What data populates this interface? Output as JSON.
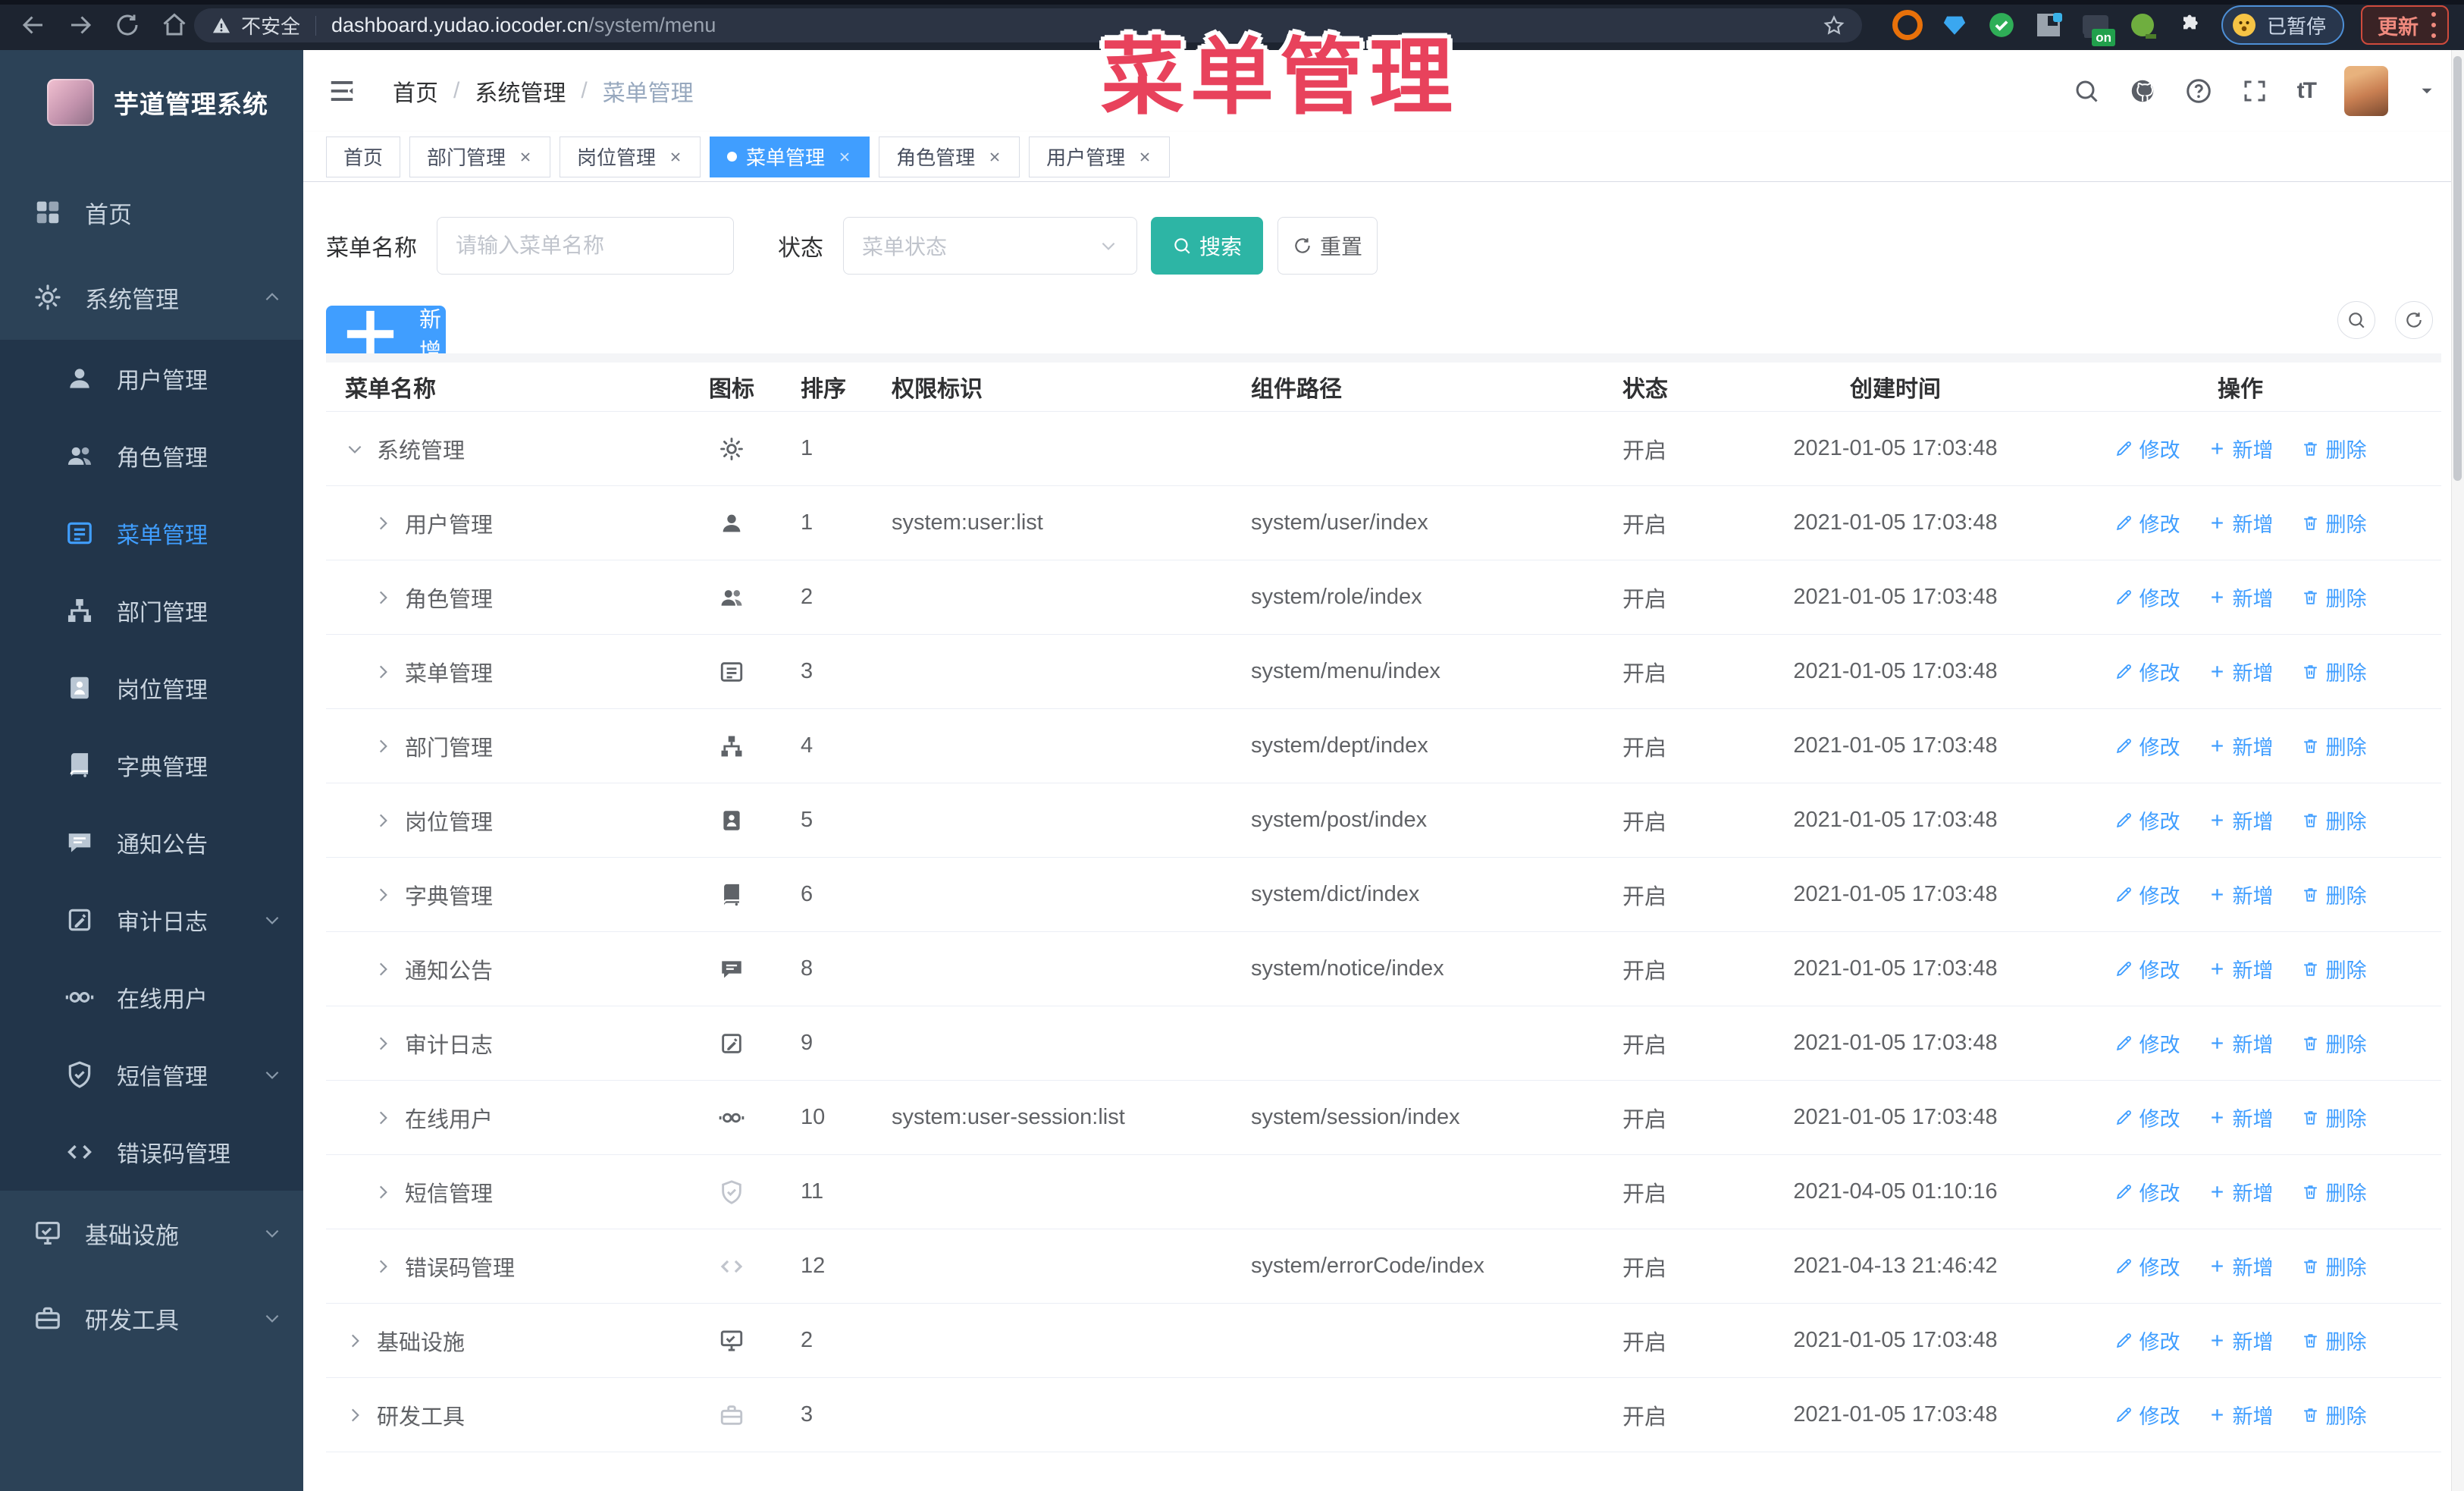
{
  "browser": {
    "security_label": "不安全",
    "url_host": "dashboard.yudao.iocoder.cn",
    "url_path": "/system/menu",
    "extension_on_label": "on",
    "paused_badge_label": "已暂停",
    "update_button_label": "更新"
  },
  "sidebar": {
    "logo_title": "芋道管理系统",
    "menu": [
      {
        "label": "首页",
        "icon": "dashboard-icon",
        "type": "top"
      },
      {
        "label": "系统管理",
        "icon": "gear-icon",
        "type": "top",
        "caret": "up",
        "expanded": true
      },
      {
        "label": "用户管理",
        "icon": "user-icon",
        "type": "sub"
      },
      {
        "label": "角色管理",
        "icon": "users-icon",
        "type": "sub"
      },
      {
        "label": "菜单管理",
        "icon": "menu-list-icon",
        "type": "sub",
        "active": true
      },
      {
        "label": "部门管理",
        "icon": "org-tree-icon",
        "type": "sub"
      },
      {
        "label": "岗位管理",
        "icon": "badge-icon",
        "type": "sub"
      },
      {
        "label": "字典管理",
        "icon": "dictionary-icon",
        "type": "sub"
      },
      {
        "label": "通知公告",
        "icon": "announcement-icon",
        "type": "sub"
      },
      {
        "label": "审计日志",
        "icon": "audit-log-icon",
        "type": "sub",
        "caret": "down"
      },
      {
        "label": "在线用户",
        "icon": "online-user-icon",
        "type": "sub"
      },
      {
        "label": "短信管理",
        "icon": "sms-shield-icon",
        "type": "sub",
        "caret": "down"
      },
      {
        "label": "错误码管理",
        "icon": "error-code-icon",
        "type": "sub"
      },
      {
        "label": "基础设施",
        "icon": "infrastructure-icon",
        "type": "top",
        "caret": "down"
      },
      {
        "label": "研发工具",
        "icon": "dev-tools-icon",
        "type": "top",
        "caret": "down"
      }
    ]
  },
  "navbar": {
    "breadcrumb_separator": "/",
    "breadcrumbs": [
      {
        "label": "首页"
      },
      {
        "label": "系统管理"
      },
      {
        "label": "菜单管理",
        "current": true
      }
    ]
  },
  "tabs": [
    {
      "label": "首页"
    },
    {
      "label": "部门管理",
      "closable": true
    },
    {
      "label": "岗位管理",
      "closable": true
    },
    {
      "label": "菜单管理",
      "closable": true,
      "active": true
    },
    {
      "label": "角色管理",
      "closable": true
    },
    {
      "label": "用户管理",
      "closable": true
    }
  ],
  "overlay_title": "菜单管理",
  "filter": {
    "name_label": "菜单名称",
    "name_placeholder": "请输入菜单名称",
    "name_value": "",
    "status_label": "状态",
    "status_placeholder": "菜单状态",
    "search_label": "搜索",
    "reset_label": "重置"
  },
  "toolbar": {
    "add_label": "新增"
  },
  "table": {
    "columns": [
      "菜单名称",
      "图标",
      "排序",
      "权限标识",
      "组件路径",
      "状态",
      "创建时间",
      "操作"
    ],
    "row_actions": {
      "edit": "修改",
      "add": "新增",
      "delete": "删除"
    },
    "rows": [
      {
        "name": "系统管理",
        "icon": "gear-icon",
        "expand": "down",
        "level": 0,
        "sort": "1",
        "permission": "",
        "path": "",
        "status": "开启",
        "created": "2021-01-05 17:03:48"
      },
      {
        "name": "用户管理",
        "icon": "user-icon",
        "expand": "right",
        "level": 1,
        "sort": "1",
        "permission": "system:user:list",
        "path": "system/user/index",
        "status": "开启",
        "created": "2021-01-05 17:03:48"
      },
      {
        "name": "角色管理",
        "icon": "users-icon",
        "expand": "right",
        "level": 1,
        "sort": "2",
        "permission": "",
        "path": "system/role/index",
        "status": "开启",
        "created": "2021-01-05 17:03:48"
      },
      {
        "name": "菜单管理",
        "icon": "menu-list-icon",
        "expand": "right",
        "level": 1,
        "sort": "3",
        "permission": "",
        "path": "system/menu/index",
        "status": "开启",
        "created": "2021-01-05 17:03:48"
      },
      {
        "name": "部门管理",
        "icon": "org-tree-icon",
        "expand": "right",
        "level": 1,
        "sort": "4",
        "permission": "",
        "path": "system/dept/index",
        "status": "开启",
        "created": "2021-01-05 17:03:48"
      },
      {
        "name": "岗位管理",
        "icon": "badge-icon",
        "expand": "right",
        "level": 1,
        "sort": "5",
        "permission": "",
        "path": "system/post/index",
        "status": "开启",
        "created": "2021-01-05 17:03:48"
      },
      {
        "name": "字典管理",
        "icon": "dictionary-icon",
        "expand": "right",
        "level": 1,
        "sort": "6",
        "permission": "",
        "path": "system/dict/index",
        "status": "开启",
        "created": "2021-01-05 17:03:48"
      },
      {
        "name": "通知公告",
        "icon": "announcement-icon",
        "expand": "right",
        "level": 1,
        "sort": "8",
        "permission": "",
        "path": "system/notice/index",
        "status": "开启",
        "created": "2021-01-05 17:03:48"
      },
      {
        "name": "审计日志",
        "icon": "audit-log-icon",
        "expand": "right",
        "level": 1,
        "sort": "9",
        "permission": "",
        "path": "",
        "status": "开启",
        "created": "2021-01-05 17:03:48"
      },
      {
        "name": "在线用户",
        "icon": "online-user-icon",
        "expand": "right",
        "level": 1,
        "sort": "10",
        "permission": "system:user-session:list",
        "path": "system/session/index",
        "status": "开启",
        "created": "2021-01-05 17:03:48"
      },
      {
        "name": "短信管理",
        "icon": "sms-shield-icon",
        "icon_muted": true,
        "expand": "right",
        "level": 1,
        "sort": "11",
        "permission": "",
        "path": "",
        "status": "开启",
        "created": "2021-04-05 01:10:16"
      },
      {
        "name": "错误码管理",
        "icon": "error-code-icon",
        "icon_muted": true,
        "expand": "right",
        "level": 1,
        "sort": "12",
        "permission": "",
        "path": "system/errorCode/index",
        "status": "开启",
        "created": "2021-04-13 21:46:42"
      },
      {
        "name": "基础设施",
        "icon": "infrastructure-icon",
        "expand": "right",
        "level": 0,
        "sort": "2",
        "permission": "",
        "path": "",
        "status": "开启",
        "created": "2021-01-05 17:03:48"
      },
      {
        "name": "研发工具",
        "icon": "dev-tools-icon",
        "icon_muted": true,
        "expand": "right",
        "level": 0,
        "sort": "3",
        "permission": "",
        "path": "",
        "status": "开启",
        "created": "2021-01-05 17:03:48"
      }
    ]
  },
  "colors": {
    "accent": "#409eff",
    "search_button": "#2db5a5",
    "overlay_red": "#e8425c",
    "sidebar_bg": "#2c4257",
    "submenu_bg": "#22354a"
  }
}
